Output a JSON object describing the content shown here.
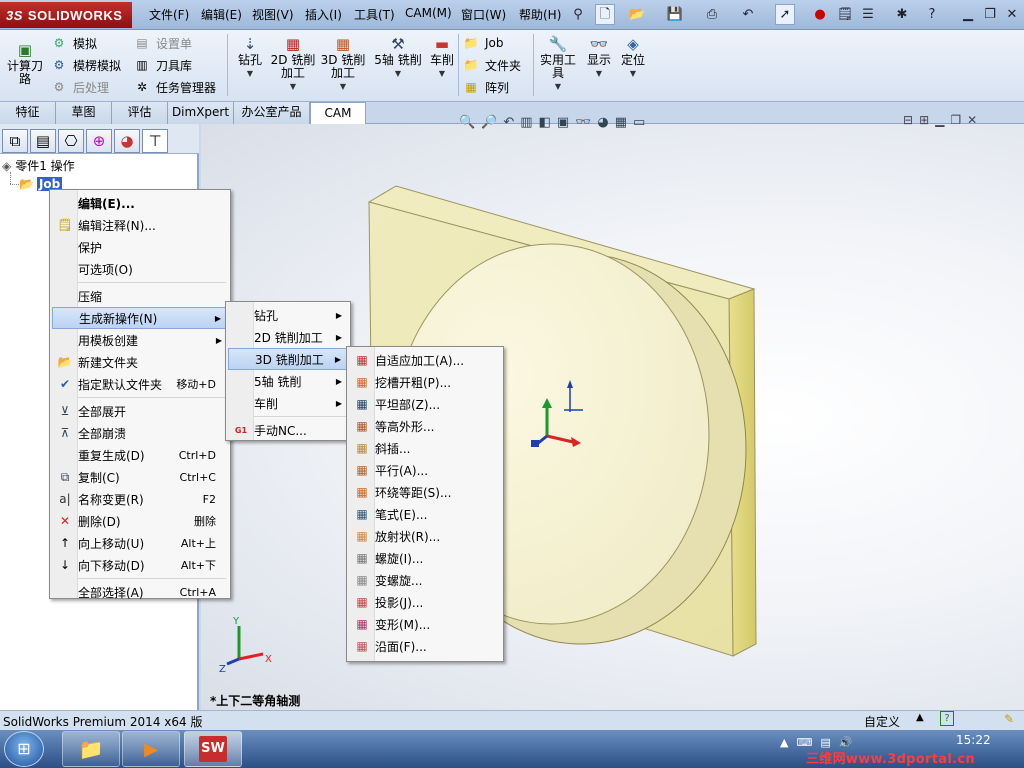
{
  "app": {
    "logo_prefix": "3S",
    "logo_text": "SOLIDWORKS"
  },
  "menubar": [
    "文件(F)",
    "编辑(E)",
    "视图(V)",
    "插入(I)",
    "工具(T)",
    "CAM(M)",
    "窗口(W)",
    "帮助(H)"
  ],
  "ribbon": {
    "calc_tool_path": "计算刀\n路",
    "simulate": "模拟",
    "model_simulate": "模楞模拟",
    "post_process": "后处理",
    "setup_sheet": "设置单",
    "tool_library": "刀具库",
    "task_manager": "任务管理器",
    "drill": "钻孔",
    "mill_2d": "2D 铣削\n加工",
    "mill_3d": "3D 铣削\n加工",
    "mill_5axis": "5轴 铣削",
    "turning": "车削",
    "job": "Job",
    "folder": "文件夹",
    "array": "阵列",
    "utility": "实用工\n具",
    "display": "显示",
    "locate": "定位"
  },
  "tabs": [
    "特征",
    "草图",
    "评估",
    "DimXpert",
    "办公室产品",
    "CAM"
  ],
  "tree": {
    "root": "零件1 操作",
    "job": "Job"
  },
  "context_menu": [
    {
      "label": "编辑(E)...",
      "shortcut": "",
      "bold": true
    },
    {
      "label": "编辑注释(N)...",
      "shortcut": "",
      "icon": "note"
    },
    {
      "label": "保护",
      "shortcut": ""
    },
    {
      "label": "可选项(O)",
      "shortcut": ""
    },
    {
      "label": "压缩",
      "shortcut": "",
      "sep_before": true
    },
    {
      "label": "生成新操作(N)",
      "shortcut": "",
      "submenu": true,
      "highlighted": true
    },
    {
      "label": "用模板创建",
      "shortcut": "",
      "submenu": true
    },
    {
      "label": "新建文件夹",
      "shortcut": "",
      "icon": "folder"
    },
    {
      "label": "指定默认文件夹",
      "shortcut": "移动+D",
      "icon": "check"
    },
    {
      "label": "全部展开",
      "shortcut": "",
      "icon": "expand",
      "sep_before": true
    },
    {
      "label": "全部崩溃",
      "shortcut": "",
      "icon": "collapse"
    },
    {
      "label": "重复生成(D)",
      "shortcut": "Ctrl+D"
    },
    {
      "label": "复制(C)",
      "shortcut": "Ctrl+C",
      "icon": "copy"
    },
    {
      "label": "名称变更(R)",
      "shortcut": "F2",
      "icon": "rename"
    },
    {
      "label": "删除(D)",
      "shortcut": "删除",
      "icon": "delete"
    },
    {
      "label": "向上移动(U)",
      "shortcut": "Alt+上",
      "icon": "up"
    },
    {
      "label": "向下移动(D)",
      "shortcut": "Alt+下",
      "icon": "down"
    },
    {
      "label": "全部选择(A)",
      "shortcut": "Ctrl+A",
      "sep_before": true
    }
  ],
  "submenu_new_op": [
    {
      "label": "钻孔",
      "submenu": true
    },
    {
      "label": "2D 铣削加工",
      "submenu": true
    },
    {
      "label": "3D 铣削加工",
      "submenu": true,
      "highlighted": true
    },
    {
      "label": "5轴 铣削",
      "submenu": true
    },
    {
      "label": "车削",
      "submenu": true
    },
    {
      "label": "手动NC...",
      "sep_before": true,
      "icon": "gcode"
    }
  ],
  "submenu_3d": [
    "自适应加工(A)...",
    "挖槽开粗(P)...",
    "平坦部(Z)...",
    "等高外形...",
    "斜插...",
    "平行(A)...",
    "环绕等距(S)...",
    "笔式(E)...",
    "放射状(R)...",
    "螺旋(I)...",
    "变螺旋...",
    "投影(J)...",
    "变形(M)...",
    "沿面(F)..."
  ],
  "viewport": {
    "view_label": "*上下二等角轴测"
  },
  "status": {
    "left": "SolidWorks Premium 2014 x64 版",
    "right": "自定义"
  },
  "taskbar": {
    "time": "15:22",
    "watermark": "三维网www.3dportal.cn"
  },
  "colors": {
    "accent": "#c62e2e",
    "highlight": "#bcd3f2",
    "part": "#f4f0c9"
  }
}
